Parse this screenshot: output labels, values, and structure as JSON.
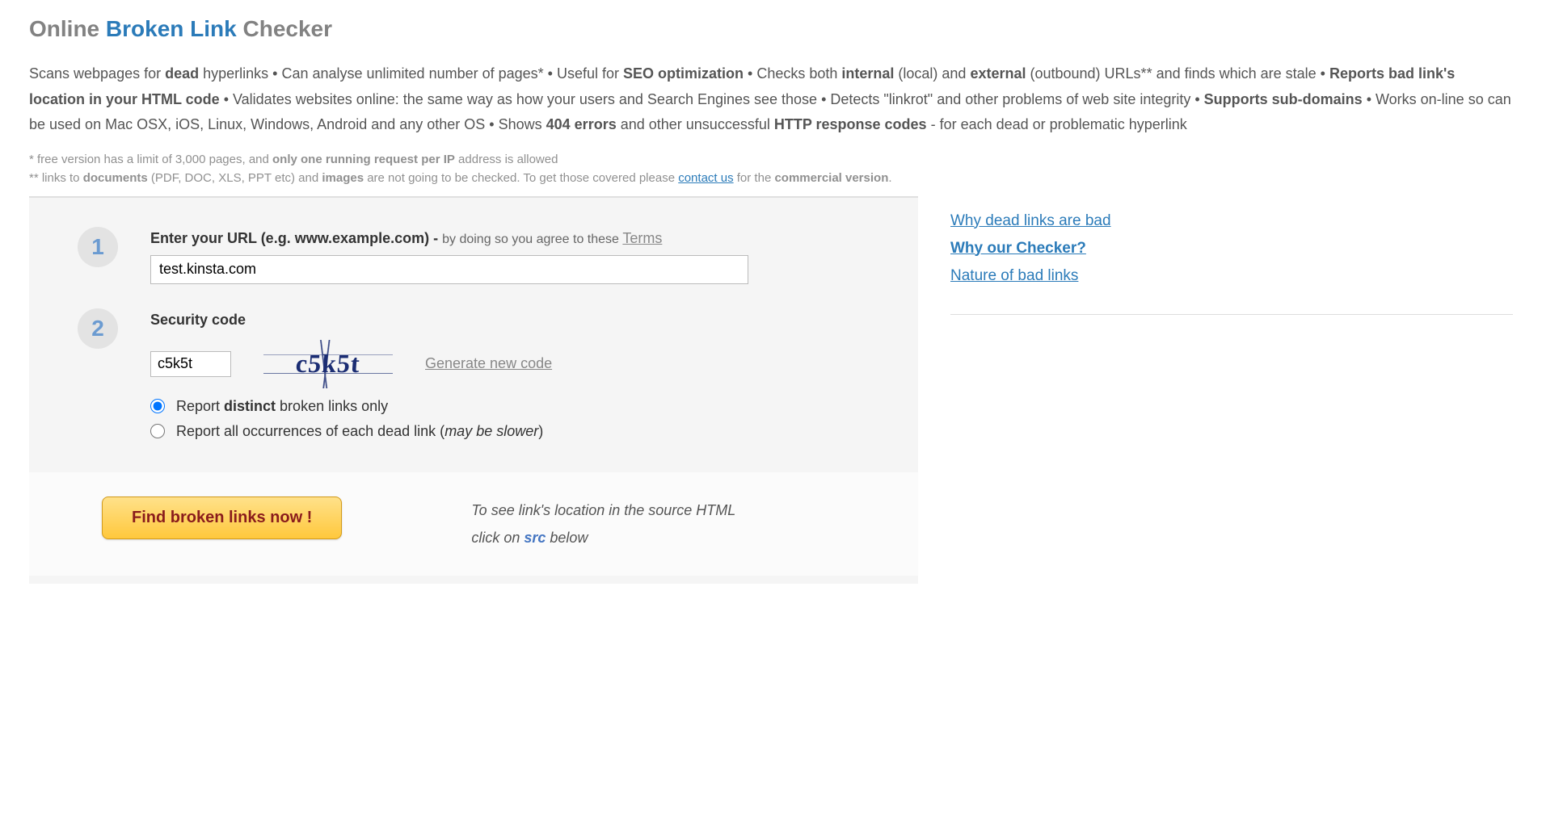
{
  "title": {
    "part1": "Online ",
    "part2": "Broken Link",
    "part3": " Checker"
  },
  "desc_parts": {
    "t1": "Scans webpages for ",
    "b1": "dead",
    "t2": " hyperlinks • Can analyse unlimited number of pages* • Useful for ",
    "b2": "SEO optimization",
    "t3": " • Checks both ",
    "b3": "internal",
    "t4": " (local) and ",
    "b4": "external",
    "t5": " (outbound) URLs** and finds which are stale • ",
    "b5": "Reports bad link's location in your HTML code",
    "t6": " • Validates websites online: the same way as how your users and Search Engines see those • Detects \"linkrot\" and other problems of web site integrity • ",
    "b6": "Supports sub-domains",
    "t7": " • Works on-line so can be used on Mac OSX, iOS, Linux, Windows, Android and any other OS • Shows ",
    "b7": "404 errors",
    "t8": " and other unsuccessful ",
    "b8": "HTTP response codes",
    "t9": " - for each dead or problematic hyperlink"
  },
  "footnote1": {
    "prefix": "*  free version has a limit of 3,000 pages, and ",
    "bold": "only one running request per IP",
    "suffix": " address is allowed"
  },
  "footnote2": {
    "prefix": "** links to ",
    "b1": "documents",
    "t1": " (PDF, DOC, XLS, PPT etc) and ",
    "b2": "images",
    "t2": " are not going to be checked. To get those covered please ",
    "link": "contact us",
    "t3": " for the ",
    "b3": "commercial version",
    "t4": "."
  },
  "step1": {
    "num": "1",
    "label_bold1": "Enter your URL (e.g. ",
    "label_bold2": "www.example.com",
    "label_bold3": ") - ",
    "label_hint": "by doing so you agree to these ",
    "terms": "Terms",
    "value": "test.kinsta.com"
  },
  "step2": {
    "num": "2",
    "label": "Security code",
    "value": "c5k5t",
    "captcha": "c5k5t",
    "generate": "Generate new code"
  },
  "radios": {
    "opt1_pre": "Report ",
    "opt1_bold": "distinct",
    "opt1_post": " broken links only",
    "opt2_pre": "Report all occurrences of each dead link (",
    "opt2_i": "may be slower",
    "opt2_post": ")"
  },
  "submit": "Find broken links now !",
  "hint": {
    "line1": "To see link's location in the source HTML",
    "line2a": "click on ",
    "line2b": "src",
    "line2c": " below"
  },
  "sidebar": {
    "link1": "Why dead links are bad",
    "link2": "Why our Checker?",
    "link3": "Nature of bad links"
  }
}
